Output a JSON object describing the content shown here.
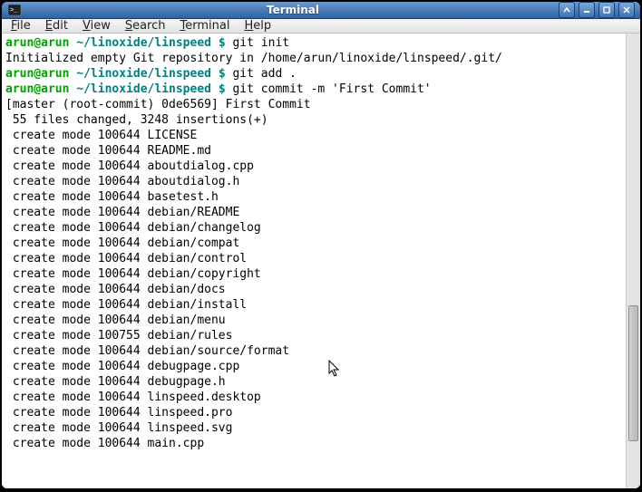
{
  "window": {
    "title": "Terminal"
  },
  "menu": {
    "file": "File",
    "edit": "Edit",
    "view": "View",
    "search": "Search",
    "terminal": "Terminal",
    "help": "Help"
  },
  "prompt": {
    "user_host": "arun@arun",
    "path": "~/linoxide/linspeed",
    "sep": " $"
  },
  "commands": {
    "c1": "git init",
    "c2": "git add .",
    "c3": "git commit -m 'First Commit'"
  },
  "output": {
    "init": "Initialized empty Git repository in /home/arun/linoxide/linspeed/.git/",
    "commit_header": "[master (root-commit) 0de6569] First Commit",
    "commit_stats": " 55 files changed, 3248 insertions(+)",
    "files": [
      " create mode 100644 LICENSE",
      " create mode 100644 README.md",
      " create mode 100644 aboutdialog.cpp",
      " create mode 100644 aboutdialog.h",
      " create mode 100644 basetest.h",
      " create mode 100644 debian/README",
      " create mode 100644 debian/changelog",
      " create mode 100644 debian/compat",
      " create mode 100644 debian/control",
      " create mode 100644 debian/copyright",
      " create mode 100644 debian/docs",
      " create mode 100644 debian/install",
      " create mode 100644 debian/menu",
      " create mode 100755 debian/rules",
      " create mode 100644 debian/source/format",
      " create mode 100644 debugpage.cpp",
      " create mode 100644 debugpage.h",
      " create mode 100644 linspeed.desktop",
      " create mode 100644 linspeed.pro",
      " create mode 100644 linspeed.svg",
      " create mode 100644 main.cpp"
    ]
  }
}
